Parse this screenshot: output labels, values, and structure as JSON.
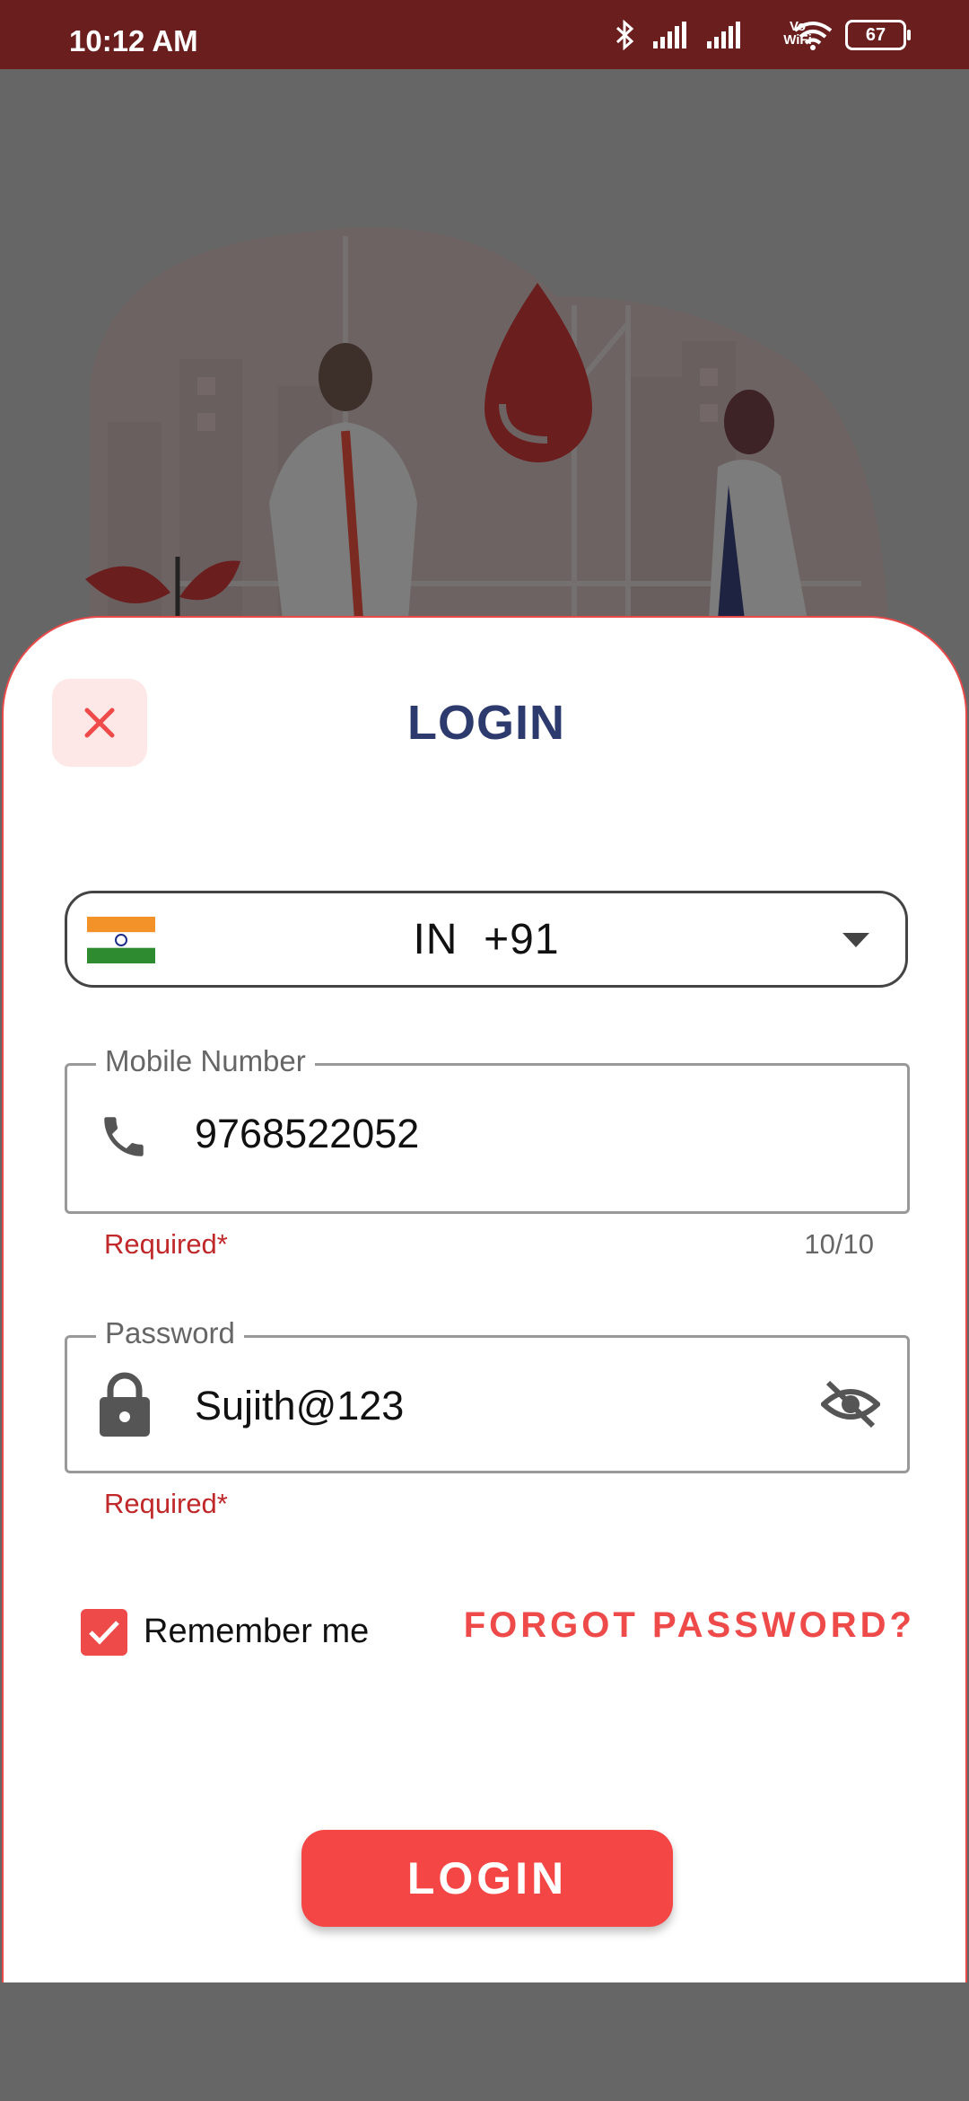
{
  "status_bar": {
    "time": "10:12 AM",
    "battery": "67",
    "vowifi_top": "Vo",
    "vowifi_bottom": "WiFi"
  },
  "login_sheet": {
    "title": "LOGIN",
    "country": {
      "code": "IN",
      "dial_code": "+91"
    },
    "mobile": {
      "label": "Mobile Number",
      "value": "9768522052",
      "helper": "Required*",
      "counter": "10/10"
    },
    "password": {
      "label": "Password",
      "value": "Sujith@123",
      "helper": "Required*"
    },
    "remember_me": {
      "label": "Remember me",
      "checked": true
    },
    "forgot_password": "FORGOT PASSWORD?",
    "login_button": "LOGIN"
  },
  "colors": {
    "accent": "#ef4a4a",
    "title": "#2d3a6e",
    "status_bar": "#6b1e1e",
    "error": "#c0282a"
  }
}
